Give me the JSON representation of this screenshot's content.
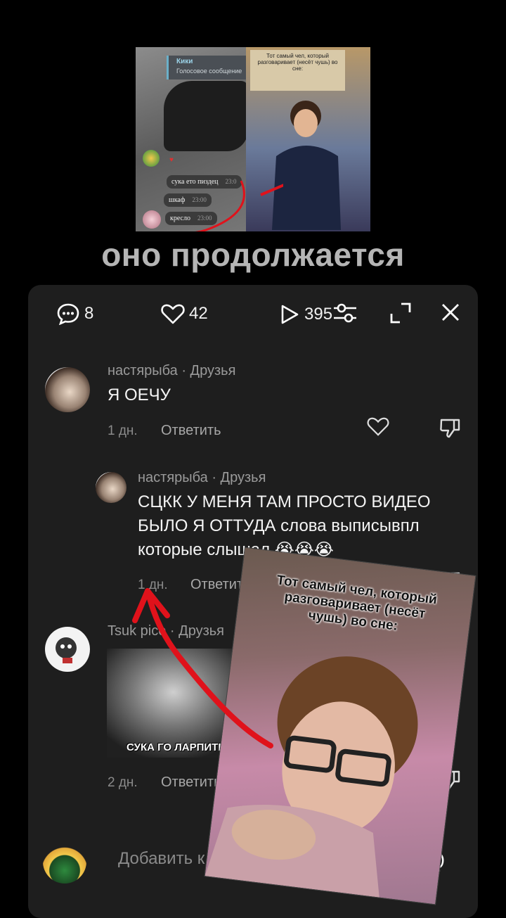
{
  "collage": {
    "chat_name": "Кики",
    "chat_sub": "Голосовое сообщение",
    "messages": [
      {
        "text": "сука ето пиздец",
        "time": "23:0"
      },
      {
        "text": "шкаф",
        "time": "23:00"
      },
      {
        "text": "кресло",
        "time": "23:00"
      }
    ],
    "note": "Тот самый чел, который разговаривает (несёт чушь) во сне:"
  },
  "caption": "оно продолжается",
  "toolbar": {
    "comments_count": "8",
    "likes_count": "42",
    "plays_count": "395"
  },
  "comments": [
    {
      "username": "настярыба · Друзья",
      "text": "Я ОЕЧУ",
      "age": "1 дн.",
      "reply_label": "Ответить"
    },
    {
      "username": "настярыба · Друзья",
      "text": "СЦКК У МЕНЯ ТАМ ПРОСТО ВИДЕО БЫЛО Я ОТТУДА слова выписывпл которые слышал 😭😭😭",
      "age": "1 дн.",
      "reply_label": "Ответить"
    },
    {
      "username": "Tsuk   pice · Друзья",
      "image_caption": "СУКА ГО ЛАРПИТЬ",
      "age": "2 дн.",
      "reply_label": "Ответить"
    }
  ],
  "composer": {
    "placeholder": "Добавить к",
    "at_symbol": "@"
  },
  "overlay": {
    "note": "Тот самый чел, который разговаривает (несёт чушь) во сне:"
  },
  "colors": {
    "panel": "#1e1e1e",
    "arrow": "#e0121b",
    "caption": "#b5b5b5"
  }
}
